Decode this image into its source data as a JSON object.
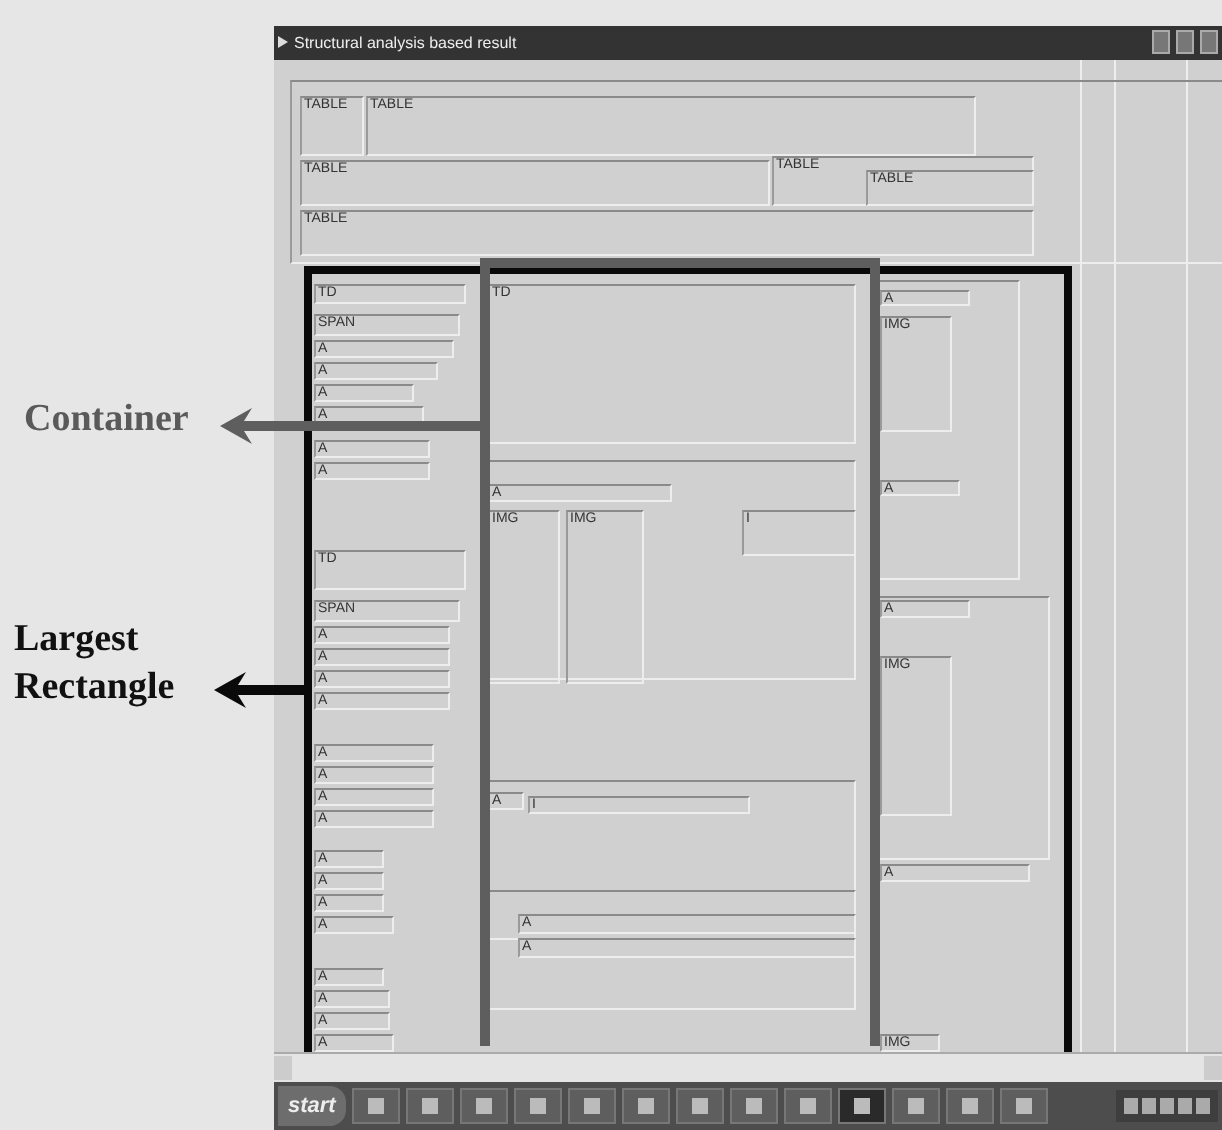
{
  "annotations": [
    {
      "kind": "container",
      "text": "Container"
    },
    {
      "kind": "largest",
      "text": "Largest Rectangle"
    }
  ],
  "window": {
    "title": "Structural analysis based result"
  },
  "boxes": [
    {
      "label": "TABLE"
    },
    {
      "label": "TABLE"
    },
    {
      "label": "TABLE"
    },
    {
      "label": "TABLE"
    },
    {
      "label": "TABLE"
    },
    {
      "label": "TABLE"
    },
    {
      "label": "TD"
    },
    {
      "label": "SPAN"
    },
    {
      "label": "A"
    },
    {
      "label": "A"
    },
    {
      "label": "A"
    },
    {
      "label": "A"
    },
    {
      "label": "A"
    },
    {
      "label": "A"
    },
    {
      "label": "TD"
    },
    {
      "label": "SPAN"
    },
    {
      "label": "A"
    },
    {
      "label": "A"
    },
    {
      "label": "A"
    },
    {
      "label": "A"
    },
    {
      "label": "A"
    },
    {
      "label": "A"
    },
    {
      "label": "A"
    },
    {
      "label": "A"
    },
    {
      "label": "A"
    },
    {
      "label": "A"
    },
    {
      "label": "A"
    },
    {
      "label": "A"
    },
    {
      "label": "A"
    },
    {
      "label": "A"
    },
    {
      "label": "A"
    },
    {
      "label": "A"
    },
    {
      "label": "TD"
    },
    {
      "label": "A"
    },
    {
      "label": "IMG"
    },
    {
      "label": "IMG"
    },
    {
      "label": "I"
    },
    {
      "label": "A"
    },
    {
      "label": "I"
    },
    {
      "label": "A"
    },
    {
      "label": "A"
    },
    {
      "label": "A"
    },
    {
      "label": "IMG"
    },
    {
      "label": "A"
    },
    {
      "label": "A"
    },
    {
      "label": "IMG"
    },
    {
      "label": "A"
    },
    {
      "label": "IMG"
    }
  ],
  "taskbar": {
    "start": "start"
  }
}
